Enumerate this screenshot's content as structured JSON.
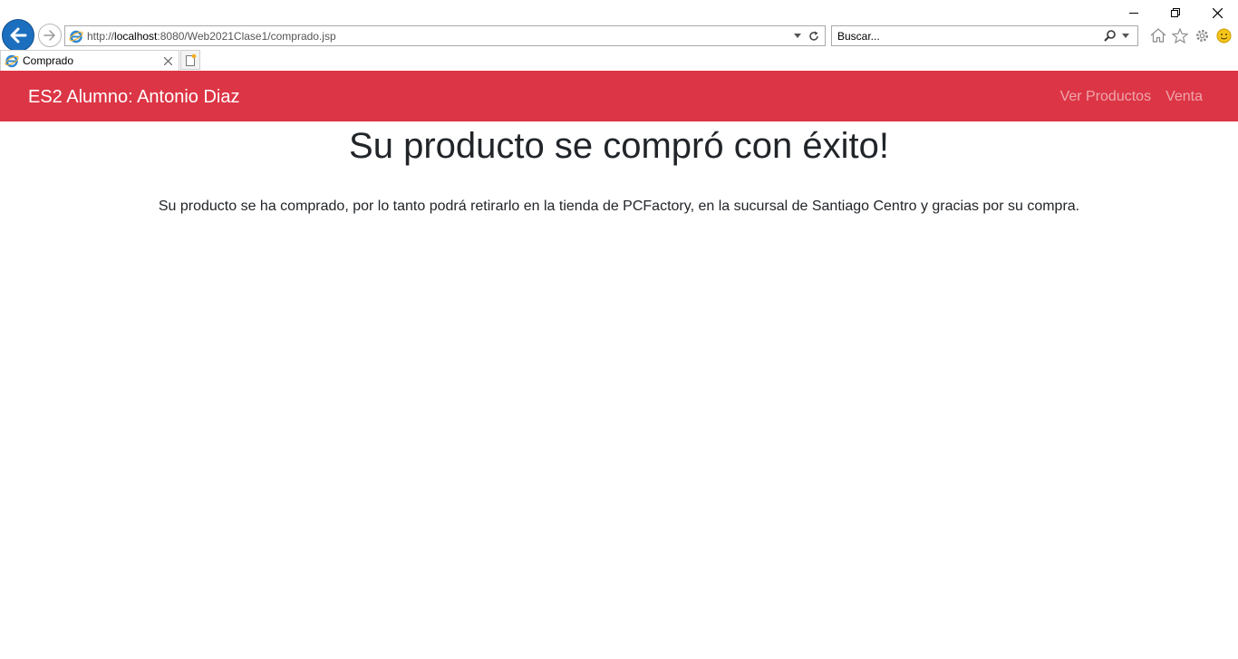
{
  "browser": {
    "url_prefix": "http://",
    "url_host": "localhost",
    "url_path": ":8080/Web2021Clase1/comprado.jsp",
    "search_placeholder": "Buscar...",
    "tab_title": "Comprado",
    "accent_color": "#1c6fbf"
  },
  "navbar": {
    "brand": "ES2 Alumno: Antonio Diaz",
    "links": [
      "Ver Productos",
      "Venta"
    ],
    "background_color": "#dc3545"
  },
  "main": {
    "headline": "Su producto se compró con éxito!",
    "message": "Su producto se ha comprado, por lo tanto podrá retirarlo en la tienda de PCFactory, en la sucursal de Santiago Centro y gracias por su compra."
  },
  "icons": [
    "back-arrow-icon",
    "forward-arrow-icon",
    "ie-logo-icon",
    "dropdown-icon",
    "refresh-icon",
    "search-icon",
    "home-icon",
    "favorites-star-icon",
    "settings-gear-icon",
    "smiley-feedback-icon",
    "close-icon",
    "new-tab-icon",
    "minimize-icon",
    "restore-icon"
  ]
}
